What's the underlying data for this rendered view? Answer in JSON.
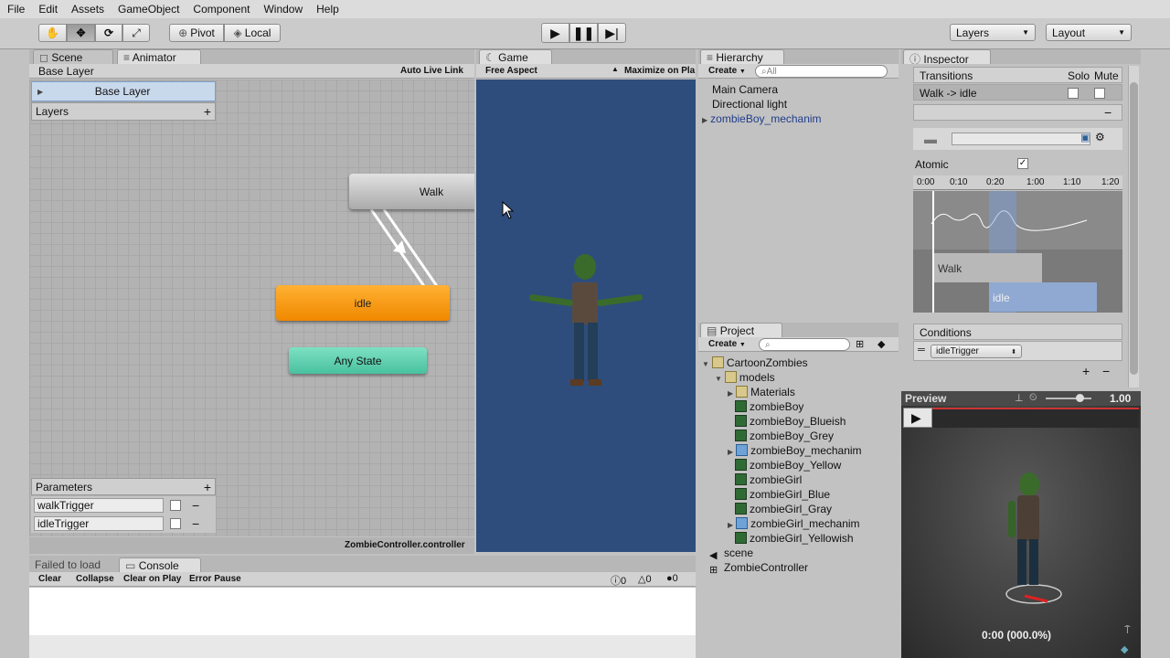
{
  "menu": [
    "File",
    "Edit",
    "Assets",
    "GameObject",
    "Component",
    "Window",
    "Help"
  ],
  "toolbar": {
    "pivot_label": "Pivot",
    "local_label": "Local",
    "layers_dropdown": "Layers",
    "layout_dropdown": "Layout"
  },
  "animator": {
    "tab_scene": "Scene",
    "tab_animator": "Animator",
    "breadcrumb": "Base Layer",
    "auto_live_link": "Auto Live Link",
    "layer_item": "Base Layer",
    "layers_header": "Layers",
    "states": {
      "walk": "Walk",
      "idle": "idle",
      "any": "Any State"
    },
    "parameters_header": "Parameters",
    "parameters": [
      "walkTrigger",
      "idleTrigger"
    ],
    "controller_file": "ZombieController.controller"
  },
  "game": {
    "tab": "Game",
    "aspect": "Free Aspect",
    "maximize": "Maximize on Pla"
  },
  "hierarchy": {
    "tab": "Hierarchy",
    "create": "Create",
    "search_placeholder": "All",
    "items": [
      "Main Camera",
      "Directional light",
      "zombieBoy_mechanim"
    ]
  },
  "project": {
    "tab": "Project",
    "create": "Create",
    "items": [
      {
        "label": "CartoonZombies",
        "icon": "folder"
      },
      {
        "label": "models",
        "icon": "folder"
      },
      {
        "label": "Materials",
        "icon": "folder"
      },
      {
        "label": "zombieBoy",
        "icon": "model"
      },
      {
        "label": "zombieBoy_Blueish",
        "icon": "model"
      },
      {
        "label": "zombieBoy_Grey",
        "icon": "model"
      },
      {
        "label": "zombieBoy_mechanim",
        "icon": "mech"
      },
      {
        "label": "zombieBoy_Yellow",
        "icon": "model"
      },
      {
        "label": "zombieGirl",
        "icon": "model"
      },
      {
        "label": "zombieGirl_Blue",
        "icon": "model"
      },
      {
        "label": "zombieGirl_Gray",
        "icon": "model"
      },
      {
        "label": "zombieGirl_mechanim",
        "icon": "mech"
      },
      {
        "label": "zombieGirl_Yellowish",
        "icon": "model"
      },
      {
        "label": "scene",
        "icon": "unity"
      },
      {
        "label": "ZombieController",
        "icon": "controller"
      }
    ]
  },
  "inspector": {
    "tab": "Inspector",
    "transitions": "Transitions",
    "solo": "Solo",
    "mute": "Mute",
    "transition_item": "Walk -> idle",
    "atomic": "Atomic",
    "timeline_ticks": [
      "0:00",
      "0:10",
      "0:20",
      "1:00",
      "1:10",
      "1:20"
    ],
    "clip_walk": "Walk",
    "clip_idle": "idle",
    "conditions": "Conditions",
    "condition_param": "idleTrigger"
  },
  "preview": {
    "label": "Preview",
    "speed": "1.00",
    "time": "0:00 (000.0%)"
  },
  "console": {
    "tab_failed": "Failed to load",
    "tab_console": "Console",
    "clear": "Clear",
    "collapse": "Collapse",
    "clear_on_play": "Clear on Play",
    "error_pause": "Error Pause",
    "counts": [
      "0",
      "0",
      "0"
    ]
  },
  "colors": {
    "idle_state": "#f39a00",
    "any_state": "#56cfae",
    "game_bg": "#2e4d7c",
    "selection": "#b9cfe8"
  }
}
